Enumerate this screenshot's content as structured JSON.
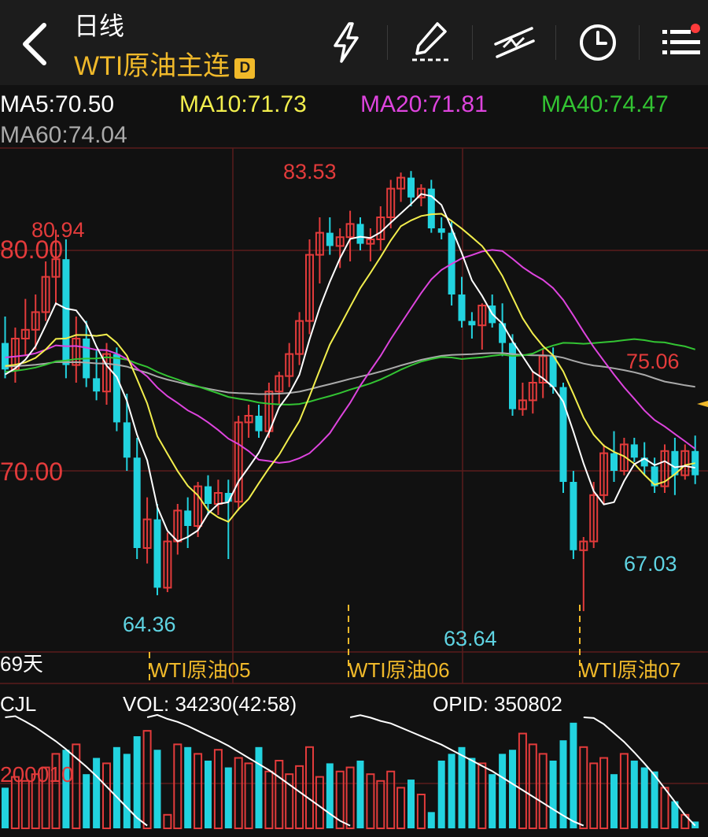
{
  "header": {
    "period": "日线",
    "instrument": "WTI原油主连",
    "badge": "D"
  },
  "toolbar": [
    "flash-icon",
    "draw-pen-icon",
    "trend-line-icon",
    "clock-icon",
    "menu-icon"
  ],
  "ma": {
    "ma5": "MA5:70.50",
    "ma10": "MA10:71.73",
    "ma20": "MA20:71.81",
    "ma40": "MA40:74.47",
    "ma60": "MA60:74.04"
  },
  "colors": {
    "up": "#e33b3b",
    "down": "#22d3df",
    "ma5": "#ffffff",
    "ma10": "#f2ee4d",
    "ma20": "#de44de",
    "ma40": "#33c433",
    "ma60": "#aaaaaa",
    "accent": "#f0b92a"
  },
  "price_panel": {
    "period_count": "69天",
    "price_labels": [
      "80.00",
      "70.00"
    ],
    "annotations": {
      "high_1": "80.94",
      "high_2": "83.53",
      "low_1": "64.36",
      "low_2": "63.64",
      "low_3": "67.03",
      "last": "75.06"
    },
    "contract_labels": [
      "WTI原油05",
      "WTI原油06",
      "WTI原油07"
    ]
  },
  "volume_panel": {
    "name": "CJL",
    "vol": "VOL: 34230(42:58)",
    "opid": "OPID: 350802",
    "axis_label": "200010"
  },
  "chart_data": {
    "type": "candlestick",
    "y_price_range": [
      62,
      86
    ],
    "count": 69,
    "ohlc": [
      [
        75.8,
        77.0,
        74.2,
        74.6
      ],
      [
        74.6,
        76.5,
        74.0,
        76.0
      ],
      [
        76.0,
        77.8,
        75.2,
        76.4
      ],
      [
        76.4,
        78.0,
        75.5,
        77.2
      ],
      [
        77.2,
        79.5,
        76.8,
        78.8
      ],
      [
        78.8,
        80.94,
        77.5,
        79.6
      ],
      [
        79.6,
        80.5,
        74.2,
        74.8
      ],
      [
        74.8,
        77.0,
        74.0,
        76.0
      ],
      [
        76.0,
        76.8,
        73.8,
        74.2
      ],
      [
        74.2,
        75.5,
        73.2,
        73.6
      ],
      [
        73.6,
        75.8,
        73.0,
        75.3
      ],
      [
        75.3,
        75.6,
        71.8,
        72.2
      ],
      [
        72.2,
        73.5,
        70.0,
        70.6
      ],
      [
        70.6,
        71.5,
        66.0,
        66.5
      ],
      [
        66.5,
        68.8,
        65.8,
        67.8
      ],
      [
        67.8,
        68.5,
        64.36,
        64.7
      ],
      [
        64.7,
        67.2,
        64.5,
        66.8
      ],
      [
        66.8,
        68.5,
        66.2,
        68.2
      ],
      [
        68.2,
        68.8,
        66.5,
        67.5
      ],
      [
        67.5,
        69.5,
        67.0,
        69.3
      ],
      [
        69.3,
        69.8,
        68.0,
        68.5
      ],
      [
        68.5,
        69.6,
        68.0,
        69.0
      ],
      [
        69.0,
        69.6,
        66.0,
        68.6
      ],
      [
        68.6,
        72.5,
        68.2,
        72.2
      ],
      [
        72.2,
        73.0,
        71.5,
        72.5
      ],
      [
        72.5,
        73.0,
        71.5,
        71.8
      ],
      [
        71.8,
        74.0,
        71.5,
        73.6
      ],
      [
        73.6,
        74.5,
        73.0,
        74.3
      ],
      [
        74.3,
        75.8,
        73.8,
        75.3
      ],
      [
        75.3,
        77.2,
        74.8,
        76.8
      ],
      [
        76.8,
        80.5,
        76.2,
        79.8
      ],
      [
        79.8,
        81.5,
        78.5,
        80.8
      ],
      [
        80.8,
        81.5,
        79.8,
        80.2
      ],
      [
        80.2,
        81.0,
        79.2,
        80.6
      ],
      [
        80.6,
        81.8,
        79.5,
        81.2
      ],
      [
        81.2,
        81.5,
        80.0,
        80.3
      ],
      [
        80.3,
        81.0,
        79.5,
        80.5
      ],
      [
        80.5,
        82.0,
        80.0,
        81.5
      ],
      [
        81.5,
        83.2,
        81.0,
        82.8
      ],
      [
        82.8,
        83.53,
        82.2,
        83.3
      ],
      [
        83.3,
        83.6,
        82.0,
        82.4
      ],
      [
        82.4,
        83.0,
        82.0,
        82.8
      ],
      [
        82.8,
        83.2,
        80.8,
        81.0
      ],
      [
        81.0,
        81.5,
        80.5,
        80.8
      ],
      [
        80.8,
        81.3,
        77.5,
        78.0
      ],
      [
        78.0,
        78.8,
        76.5,
        76.8
      ],
      [
        76.8,
        77.2,
        76.0,
        76.6
      ],
      [
        76.6,
        77.6,
        75.5,
        77.5
      ],
      [
        77.5,
        78.0,
        76.5,
        76.7
      ],
      [
        76.7,
        77.6,
        75.2,
        75.8
      ],
      [
        75.8,
        76.2,
        72.5,
        72.8
      ],
      [
        72.8,
        74.0,
        72.5,
        73.2
      ],
      [
        73.2,
        74.5,
        72.6,
        74.0
      ],
      [
        74.0,
        75.5,
        73.3,
        75.2
      ],
      [
        75.2,
        75.6,
        73.5,
        73.8
      ],
      [
        73.8,
        74.0,
        69.0,
        69.5
      ],
      [
        69.5,
        70.0,
        66.0,
        66.4
      ],
      [
        66.4,
        67.0,
        63.64,
        66.8
      ],
      [
        66.8,
        69.5,
        66.5,
        68.9
      ],
      [
        68.9,
        71.2,
        68.5,
        70.8
      ],
      [
        70.8,
        71.8,
        69.5,
        70.0
      ],
      [
        70.0,
        71.5,
        69.8,
        71.2
      ],
      [
        71.2,
        71.5,
        70.4,
        70.6
      ],
      [
        70.6,
        71.3,
        69.8,
        70.2
      ],
      [
        70.2,
        70.6,
        69.0,
        69.3
      ],
      [
        69.3,
        71.2,
        69.0,
        70.9
      ],
      [
        70.9,
        71.5,
        68.9,
        69.8
      ],
      [
        69.8,
        71.2,
        69.6,
        70.9
      ],
      [
        70.9,
        71.6,
        69.4,
        69.8
      ]
    ],
    "series_order_note_free": true,
    "volume": [
      0.3,
      0.38,
      0.35,
      0.4,
      0.45,
      0.55,
      0.58,
      0.62,
      0.4,
      0.52,
      0.48,
      0.6,
      0.55,
      0.68,
      0.72,
      0.58,
      0.1,
      0.62,
      0.6,
      0.55,
      0.5,
      0.58,
      0.45,
      0.52,
      0.48,
      0.6,
      0.42,
      0.5,
      0.4,
      0.46,
      0.6,
      0.38,
      0.48,
      0.42,
      0.45,
      0.5,
      0.4,
      0.35,
      0.42,
      0.3,
      0.36,
      0.25,
      0.12,
      0.5,
      0.55,
      0.6,
      0.52,
      0.48,
      0.4,
      0.55,
      0.58,
      0.7,
      0.62,
      0.55,
      0.5,
      0.65,
      0.78,
      0.6,
      0.48,
      0.52,
      0.4,
      0.55,
      0.5,
      0.45,
      0.42,
      0.3,
      0.2,
      0.1,
      0.05
    ],
    "opid_line": [
      0.78,
      0.74,
      0.7,
      0.66,
      0.62,
      0.58,
      0.54,
      0.5,
      0.45,
      0.4,
      0.35,
      0.3,
      0.25,
      0.2,
      0.15,
      0.1,
      0.05
    ]
  }
}
